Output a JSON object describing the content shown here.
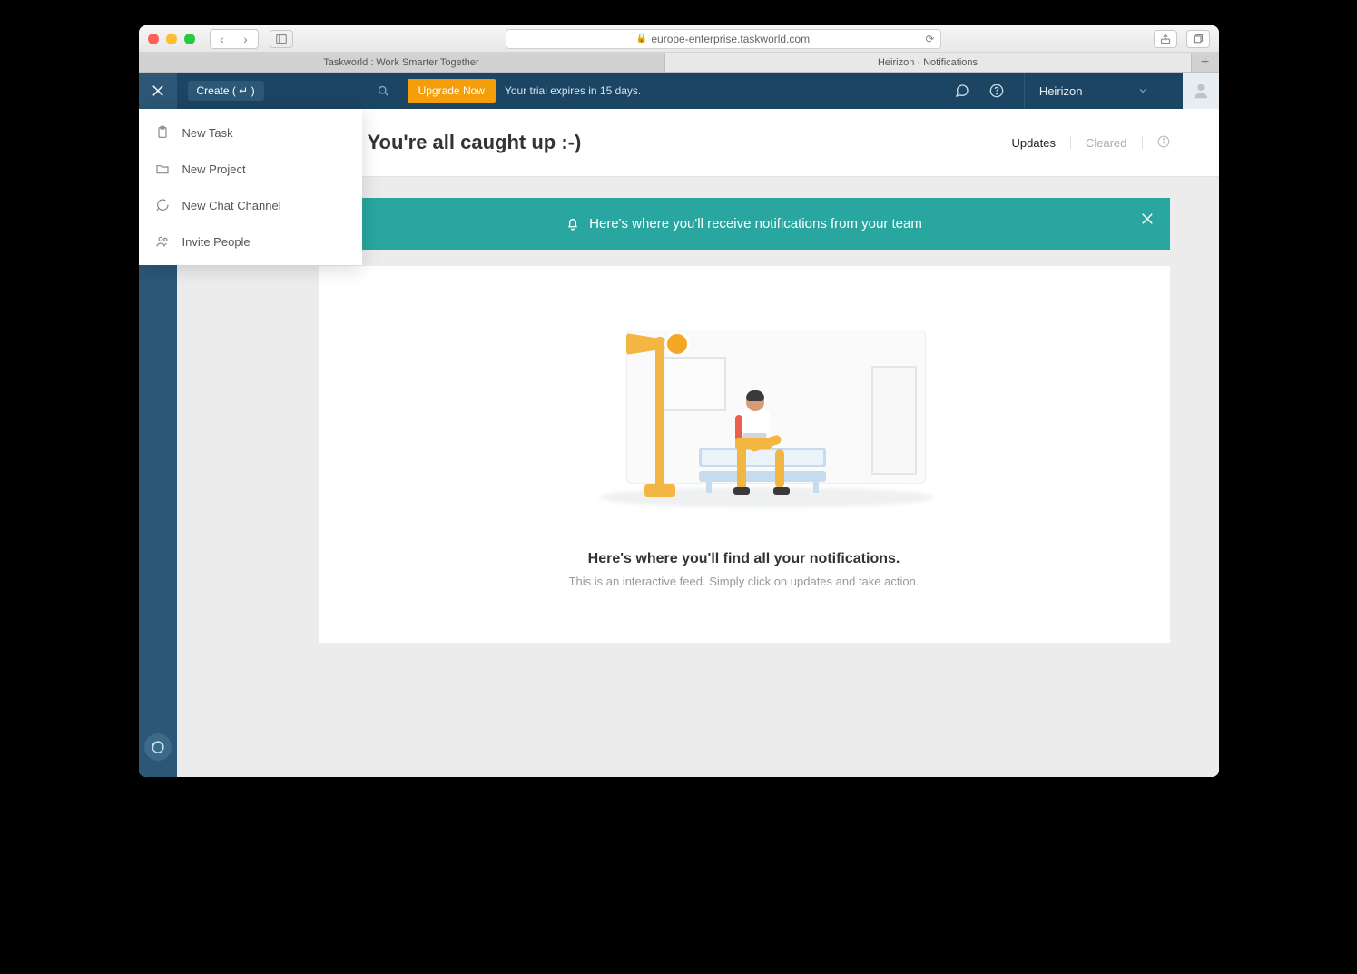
{
  "browser": {
    "url": "europe-enterprise.taskworld.com",
    "tabs": [
      {
        "title": "Taskworld : Work Smarter Together",
        "active": false
      },
      {
        "title": "Heirizon · Notifications",
        "active": true
      }
    ]
  },
  "topbar": {
    "create_label": "Create ( ↵ )",
    "upgrade_label": "Upgrade Now",
    "trial_text": "Your trial expires in 15 days.",
    "workspace_name": "Heirizon"
  },
  "create_menu": {
    "items": [
      {
        "icon": "clipboard",
        "label": "New Task"
      },
      {
        "icon": "folder",
        "label": "New Project"
      },
      {
        "icon": "chat",
        "label": "New Chat Channel"
      },
      {
        "icon": "people",
        "label": "Invite People"
      }
    ]
  },
  "page": {
    "title": "You're all caught up :-)",
    "filters": {
      "updates": "Updates",
      "cleared": "Cleared"
    },
    "banner_text": "Here's where you'll receive notifications from your team",
    "empty_title": "Here's where you'll find all your notifications.",
    "empty_sub": "This is an interactive feed. Simply click on updates and take action."
  },
  "colors": {
    "sidebar": "#2c5776",
    "topbar": "#1b4563",
    "accent_teal": "#2aa6a0",
    "accent_orange": "#f59e0b"
  }
}
